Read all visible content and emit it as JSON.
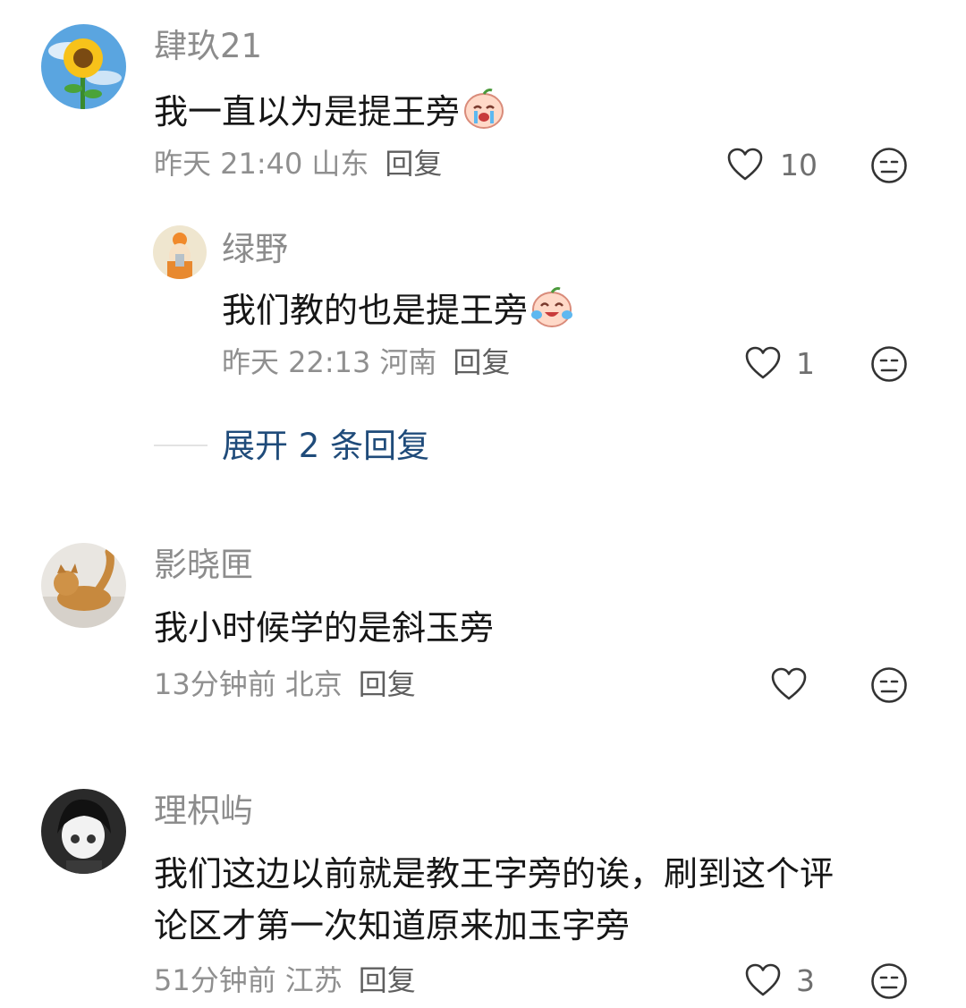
{
  "comments": [
    {
      "user": "肆玖21",
      "text": "我一直以为是提王旁",
      "time": "昨天 21:40",
      "region": "山东",
      "reply_label": "回复",
      "likes": "10",
      "sticker": "crying-face-sticker"
    },
    {
      "user": "影晓匣",
      "text": "我小时候学的是斜玉旁",
      "time": "13分钟前",
      "region": "北京",
      "reply_label": "回复",
      "likes": ""
    },
    {
      "user": "理枳屿",
      "text_line1": "我们这边以前就是教王字旁的诶，刷到这个评",
      "text_line2": "论区才第一次知道原来加玉字旁",
      "time": "51分钟前",
      "region": "江苏",
      "reply_label": "回复",
      "likes": "3"
    }
  ],
  "reply": {
    "user": "绿野",
    "text": "我们教的也是提王旁",
    "time": "昨天 22:13",
    "region": "河南",
    "reply_label": "回复",
    "likes": "1",
    "sticker": "laughing-tears-sticker"
  },
  "expand_replies": "展开 2 条回复",
  "icons": {
    "like": "heart-outline-icon",
    "dislike": "meh-face-icon"
  },
  "colors": {
    "username": "#8c8c8c",
    "meta": "#8f8f8f",
    "link": "#1f4b7a"
  }
}
